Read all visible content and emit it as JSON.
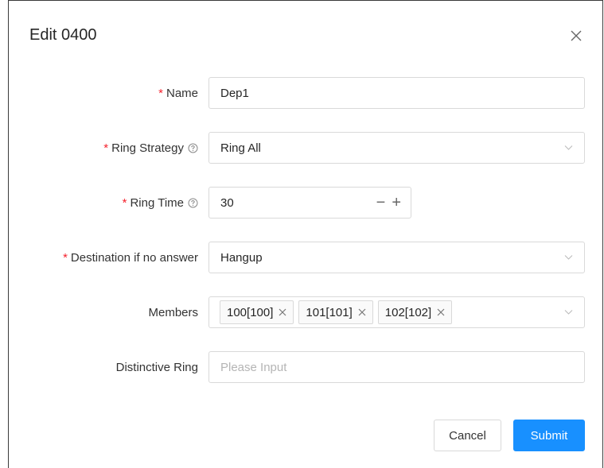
{
  "dialog": {
    "title": "Edit 0400",
    "close_icon": "close-icon"
  },
  "form": {
    "name": {
      "required": "*",
      "label": "Name",
      "value": "Dep1"
    },
    "ring_strategy": {
      "required": "*",
      "label": "Ring Strategy",
      "help_icon": "question-circle-icon",
      "value": "Ring All"
    },
    "ring_time": {
      "required": "*",
      "label": "Ring Time",
      "help_icon": "question-circle-icon",
      "value": "30",
      "decrement": "−",
      "increment": "+"
    },
    "destination": {
      "required": "*",
      "label": "Destination if no answer",
      "value": "Hangup"
    },
    "members": {
      "label": "Members",
      "tags": [
        "100[100]",
        "101[101]",
        "102[102]"
      ]
    },
    "distinctive_ring": {
      "label": "Distinctive Ring",
      "placeholder": "Please Input",
      "value": ""
    }
  },
  "footer": {
    "cancel_label": "Cancel",
    "submit_label": "Submit"
  },
  "colors": {
    "primary": "#1890ff",
    "required": "#f5222d",
    "border": "#d9d9d9",
    "placeholder": "#b5b5b5"
  }
}
